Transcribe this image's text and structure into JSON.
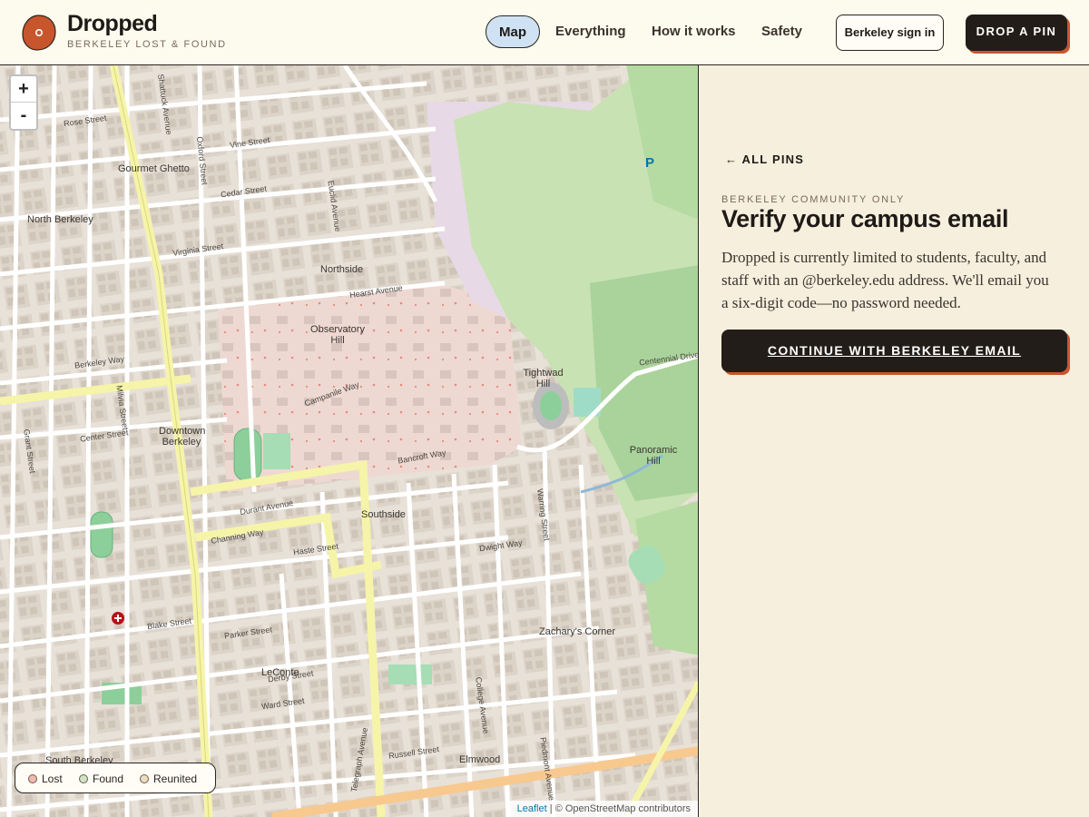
{
  "header": {
    "brand_name": "Dropped",
    "brand_subtitle": "BERKELEY LOST & FOUND",
    "logo_letter": "o",
    "nav": [
      {
        "label": "Map",
        "active": true
      },
      {
        "label": "Everything",
        "active": false
      },
      {
        "label": "How it works",
        "active": false
      },
      {
        "label": "Safety",
        "active": false
      }
    ],
    "signin_label": "Berkeley sign in",
    "drop_pin_label": "DROP A PIN"
  },
  "map": {
    "zoom_in": "+",
    "zoom_out": "-",
    "places": [
      "Gourmet Ghetto",
      "North Berkeley",
      "Northside",
      "Observatory Hill",
      "Tightwad Hill",
      "Downtown Berkeley",
      "Southside",
      "Panoramic Hill",
      "LeConte",
      "Zachary's Corner",
      "Elmwood",
      "South Berkeley"
    ],
    "streets": [
      "Rose Street",
      "Vine Street",
      "Cedar Street",
      "Virginia Street",
      "Hearst Avenue",
      "Berkeley Way",
      "Center Street",
      "Bancroft Way",
      "Durant Avenue",
      "Channing Way",
      "Haste Street",
      "Dwight Way",
      "Blake Street",
      "Parker Street",
      "Derby Street",
      "Ward Street",
      "Russell Street",
      "Shattuck Avenue",
      "Oxford Street",
      "Telegraph Avenue",
      "College Avenue",
      "Euclid Avenue",
      "Milvia Street",
      "Grant Street",
      "Campanile Way",
      "Centennial Drive",
      "Piedmont Avenue",
      "Warring Street"
    ],
    "legend": [
      {
        "label": "Lost",
        "color": "#f4b8ad"
      },
      {
        "label": "Found",
        "color": "#cfe3c2"
      },
      {
        "label": "Reunited",
        "color": "#efdcc0"
      }
    ],
    "attribution_leaflet": "Leaflet",
    "attribution_osm": "© OpenStreetMap contributors"
  },
  "panel": {
    "back_label": "ALL PINS",
    "eyebrow": "BERKELEY COMMUNITY ONLY",
    "title": "Verify your campus email",
    "body": "Dropped is currently limited to students, faculty, and staff with an @berkeley.edu address. We'll email you a six-digit code—no password needed.",
    "continue_label": "CONTINUE WITH BERKELEY EMAIL"
  },
  "colors": {
    "accent": "#c8562d",
    "dark": "#231d19",
    "nav_active_bg": "#cfe2f3",
    "panel_bg": "#f7efdd"
  }
}
